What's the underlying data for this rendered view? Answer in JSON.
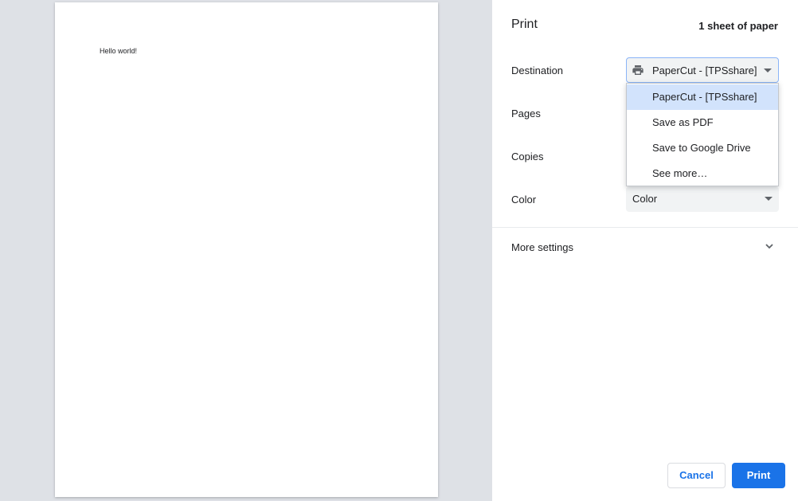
{
  "preview": {
    "page_text": "Hello world!"
  },
  "header": {
    "title": "Print",
    "sheet_count": "1 sheet of paper"
  },
  "settings": {
    "destination": {
      "label": "Destination",
      "value": "PaperCut - [TPSshare]",
      "icon": "printer-icon",
      "options": [
        "PaperCut - [TPSshare]",
        "Save as PDF",
        "Save to Google Drive",
        "See more…"
      ]
    },
    "pages": {
      "label": "Pages"
    },
    "copies": {
      "label": "Copies"
    },
    "color": {
      "label": "Color",
      "value": "Color"
    }
  },
  "more_settings": {
    "label": "More settings",
    "icon": "chevron-down-icon"
  },
  "buttons": {
    "cancel": "Cancel",
    "print": "Print"
  },
  "colors": {
    "accent": "#1a73e8",
    "selected_option_bg": "#d2e3fc",
    "select_bg": "#f1f3f4"
  }
}
